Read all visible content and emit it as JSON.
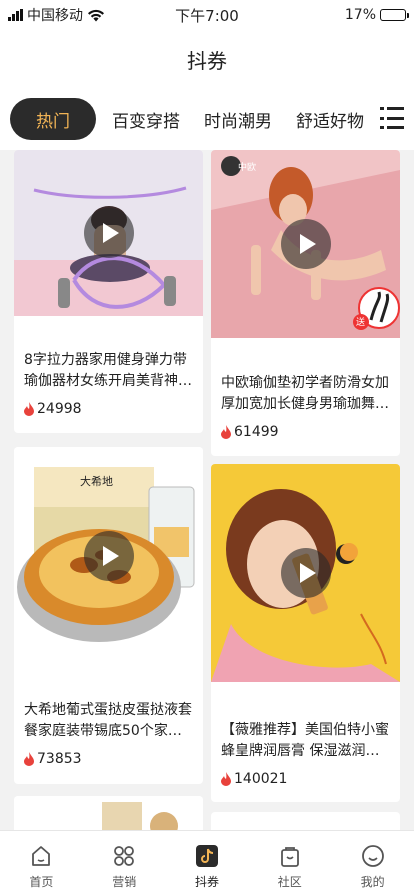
{
  "status_bar": {
    "carrier": "中国移动",
    "time": "下午7:00",
    "battery": "17%",
    "battery_level": 0.17
  },
  "header": {
    "title": "抖券"
  },
  "category_tabs": [
    {
      "label": "热门",
      "active": true
    },
    {
      "label": "百变穿搭",
      "active": false
    },
    {
      "label": "时尚潮男",
      "active": false
    },
    {
      "label": "舒适好物",
      "active": false
    }
  ],
  "products": [
    {
      "desc": "8字拉力器家用健身弹力带瑜伽器材女练开肩美背神…",
      "hot": "24998"
    },
    {
      "desc": "中欧瑜伽垫初学者防滑女加厚加宽加长健身男瑜珈舞…",
      "hot": "61499",
      "logo": "中欧",
      "badge": "送"
    },
    {
      "desc": "大希地葡式蛋挞皮蛋挞液套餐家庭装带锡底50个家用…",
      "hot": "73853",
      "brand": "大希地"
    },
    {
      "desc": "【薇雅推荐】美国伯特小蜜蜂皇牌润唇膏 保湿滋润无…",
      "hot": "140021"
    }
  ],
  "bottom_nav": [
    {
      "label": "首页",
      "icon": "home-icon"
    },
    {
      "label": "营销",
      "icon": "grid-icon"
    },
    {
      "label": "抖券",
      "icon": "douyin-icon",
      "active": true
    },
    {
      "label": "社区",
      "icon": "bag-icon"
    },
    {
      "label": "我的",
      "icon": "smile-face-icon"
    }
  ],
  "colors": {
    "accent": "#f2b455",
    "flame": "#e8423c",
    "active_tab_bg": "#2b2b2b"
  }
}
